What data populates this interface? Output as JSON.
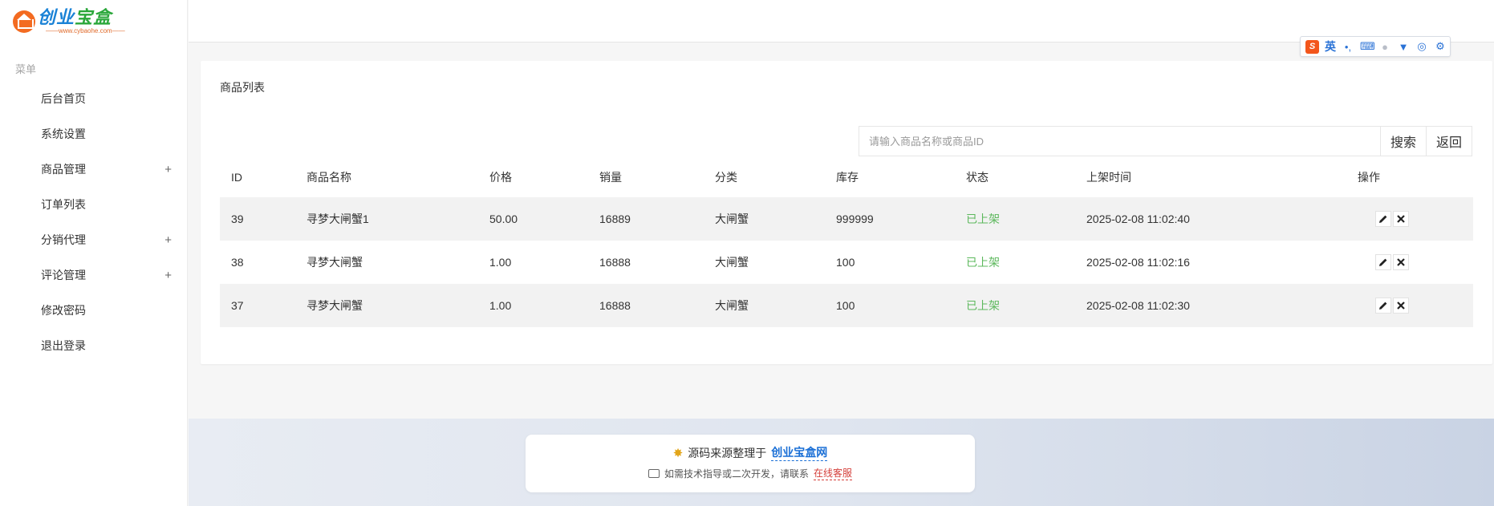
{
  "logo": {
    "title_part1": "创业",
    "title_part2": "宝盒",
    "url": "——www.cybaohe.com——"
  },
  "sidebar": {
    "menu_title": "菜单",
    "items": [
      {
        "label": "后台首页",
        "expandable": false
      },
      {
        "label": "系统设置",
        "expandable": false
      },
      {
        "label": "商品管理",
        "expandable": true
      },
      {
        "label": "订单列表",
        "expandable": false
      },
      {
        "label": "分销代理",
        "expandable": true
      },
      {
        "label": "评论管理",
        "expandable": true
      },
      {
        "label": "修改密码",
        "expandable": false
      },
      {
        "label": "退出登录",
        "expandable": false
      }
    ],
    "expand_symbol": "+"
  },
  "ime": {
    "lang": "英",
    "logo": "S"
  },
  "card": {
    "title": "商品列表",
    "search": {
      "placeholder": "请输入商品名称或商品ID",
      "value": ""
    },
    "search_button": "搜索",
    "back_button": "返回"
  },
  "table": {
    "headers": [
      "ID",
      "商品名称",
      "价格",
      "销量",
      "分类",
      "库存",
      "状态",
      "上架时间",
      "操作"
    ],
    "rows": [
      {
        "id": "39",
        "name": "寻梦大闸蟹1",
        "price": "50.00",
        "sales": "16889",
        "category": "大闸蟹",
        "stock": "999999",
        "status": "已上架",
        "time": "2025-02-08 11:02:40"
      },
      {
        "id": "38",
        "name": "寻梦大闸蟹",
        "price": "1.00",
        "sales": "16888",
        "category": "大闸蟹",
        "stock": "100",
        "status": "已上架",
        "time": "2025-02-08 11:02:16"
      },
      {
        "id": "37",
        "name": "寻梦大闸蟹",
        "price": "1.00",
        "sales": "16888",
        "category": "大闸蟹",
        "stock": "100",
        "status": "已上架",
        "time": "2025-02-08 11:02:30"
      }
    ],
    "status_color": "#5cb85c"
  },
  "footer": {
    "line1_prefix": "源码来源整理于",
    "line1_link": "创业宝盒网",
    "line2_prefix": "如需技术指导或二次开发，请联系",
    "line2_link": "在线客服"
  }
}
